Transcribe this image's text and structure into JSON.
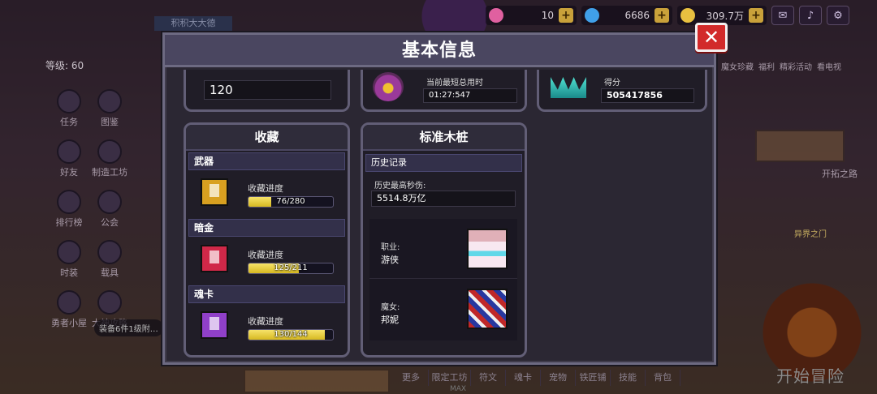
{
  "hud": {
    "level": "等级: 60",
    "title_banner": "积积大大德",
    "currencies": [
      {
        "icon": "pink-gem-icon",
        "value": "10",
        "color": "#e060a0"
      },
      {
        "icon": "blue-diamond-icon",
        "value": "6686",
        "color": "#40a0e8"
      },
      {
        "icon": "gold-coin-icon",
        "value": "309.7万",
        "color": "#e8c040"
      }
    ],
    "left_menu": [
      "任务",
      "图鉴",
      "好友",
      "制造工坊",
      "排行榜",
      "公会",
      "时装",
      "载具",
      "勇者小屋",
      "大神攻略"
    ],
    "equip_tip": "装备6件1级附…",
    "right_menu": [
      "魔女珍藏",
      "福利",
      "精彩活动",
      "看电视"
    ],
    "kaituo": "开拓之路",
    "yijie": "异界之门",
    "start_button": "开始冒险",
    "bottom_bar": [
      "更多",
      "限定工坊",
      "符文",
      "魂卡",
      "宠物",
      "铁匠铺",
      "技能",
      "背包"
    ],
    "max_tag": "MAX"
  },
  "modal": {
    "title": "基本信息",
    "close_glyph": "✕",
    "top_panels": {
      "left_value": "120",
      "middle_label": "当前最短总用时",
      "middle_value": "01:27:547",
      "right_label": "得分",
      "right_value": "505417856"
    },
    "collection": {
      "title": "收藏",
      "progress_label": "收藏进度",
      "items": [
        {
          "category": "武器",
          "progress": "76/280",
          "fraction": 0.271,
          "icon_color": "#d8a020"
        },
        {
          "category": "暗金",
          "progress": "125/211",
          "fraction": 0.592,
          "icon_color": "#d02848"
        },
        {
          "category": "魂卡",
          "progress": "130/144",
          "fraction": 0.903,
          "icon_color": "#9040c8"
        }
      ]
    },
    "dummy": {
      "title": "标准木桩",
      "history_label": "历史记录",
      "dps_label": "历史最高秒伤:",
      "dps_value": "5514.8万亿",
      "class_label": "职业:",
      "class_value": "游侠",
      "witch_label": "魔女:",
      "witch_value": "邦妮"
    }
  }
}
